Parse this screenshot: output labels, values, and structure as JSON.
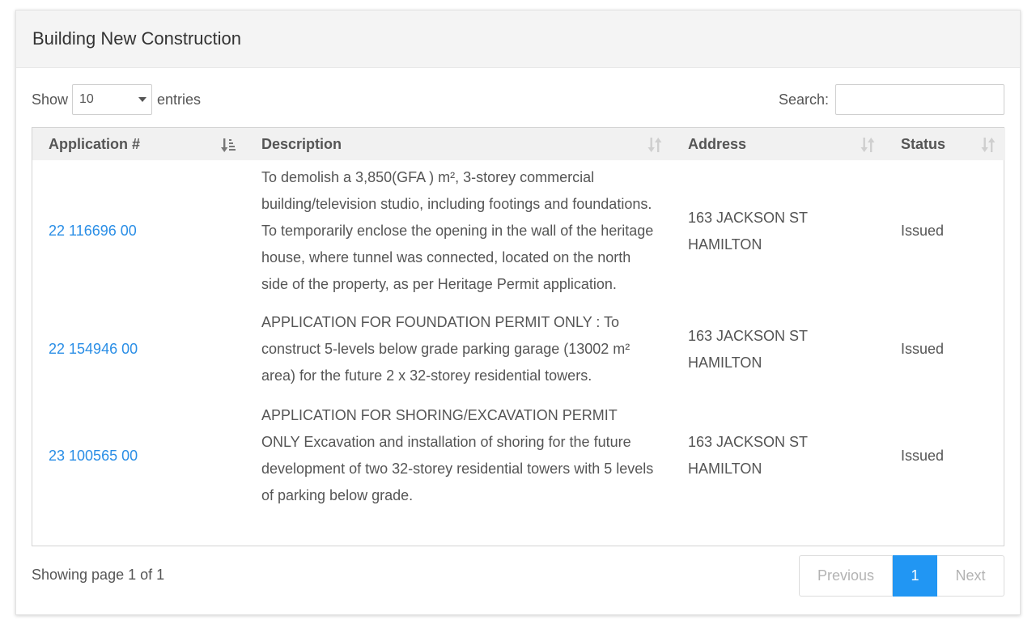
{
  "panel": {
    "title": "Building New Construction"
  },
  "length_control": {
    "show_label": "Show",
    "selected": "10",
    "entries_label": "entries"
  },
  "search": {
    "label": "Search:",
    "value": "",
    "placeholder": ""
  },
  "table": {
    "columns": [
      "Application #",
      "Description",
      "Address",
      "Status"
    ],
    "rows": [
      {
        "application": "22 116696 00",
        "description": "To demolish a 3,850(GFA ) m², 3-storey commercial building/television studio, including footings and foundations. To temporarily enclose the opening in the wall of the heritage house, where tunnel was connected, located on the north side of the property, as per Heritage Permit application.",
        "address": "163 JACKSON ST HAMILTON",
        "status": "Issued"
      },
      {
        "application": "22 154946 00",
        "description": "APPLICATION FOR FOUNDATION PERMIT ONLY : To construct 5-levels below grade parking garage (13002 m² area) for the future 2 x 32-storey residential towers.",
        "address": "163 JACKSON ST HAMILTON",
        "status": "Issued"
      },
      {
        "application": "23 100565 00",
        "description": "APPLICATION FOR SHORING/EXCAVATION PERMIT ONLY Excavation and installation of shoring for the future development of two 32-storey residential towers with 5 levels of parking below grade.",
        "address": "163 JACKSON ST HAMILTON",
        "status": "Issued"
      }
    ]
  },
  "footer": {
    "info": "Showing page 1 of 1"
  },
  "pagination": {
    "previous": "Previous",
    "current": "1",
    "next": "Next"
  },
  "colors": {
    "link": "#2a8ee6",
    "active_page": "#2196f3",
    "header_bg": "#f4f4f4"
  },
  "icons": {
    "sort_active": "sort-amount-down-icon",
    "sort_inactive": "sort-both-icon",
    "select_caret": "caret-down-icon"
  }
}
